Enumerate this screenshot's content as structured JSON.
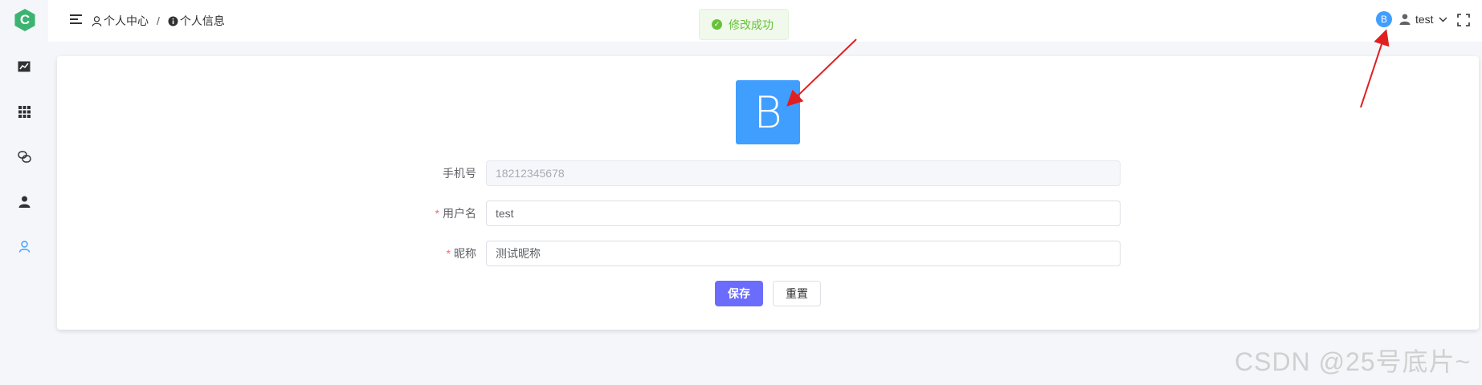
{
  "logo": {
    "letter": "C"
  },
  "sidebar": {
    "items": [
      {
        "icon": "line-chart-icon"
      },
      {
        "icon": "grid-icon"
      },
      {
        "icon": "chat-icon"
      },
      {
        "icon": "user-solid-icon"
      },
      {
        "icon": "user-outline-icon",
        "active": true
      }
    ]
  },
  "breadcrumb": {
    "items": [
      {
        "icon": "user-outline-icon",
        "label": "个人中心"
      },
      {
        "icon": "info-icon",
        "label": "个人信息"
      }
    ],
    "separator": "/"
  },
  "toast": {
    "message": "修改成功",
    "icon": "success-check-icon"
  },
  "header": {
    "avatar_letter": "B",
    "username": "test"
  },
  "profile": {
    "avatar_letter": "B",
    "fields": {
      "phone": {
        "label": "手机号",
        "value": "18212345678"
      },
      "username": {
        "label": "用户名",
        "value": "test",
        "required_mark": "*"
      },
      "nickname": {
        "label": "昵称",
        "value": "测试昵称",
        "required_mark": "*"
      }
    },
    "buttons": {
      "save": "保存",
      "reset": "重置"
    }
  },
  "watermark": "CSDN @25号底片~",
  "colors": {
    "accent": "#409eff",
    "primary_button": "#6b6cfb",
    "success": "#67c23a",
    "annotation_arrow": "#e02020"
  }
}
